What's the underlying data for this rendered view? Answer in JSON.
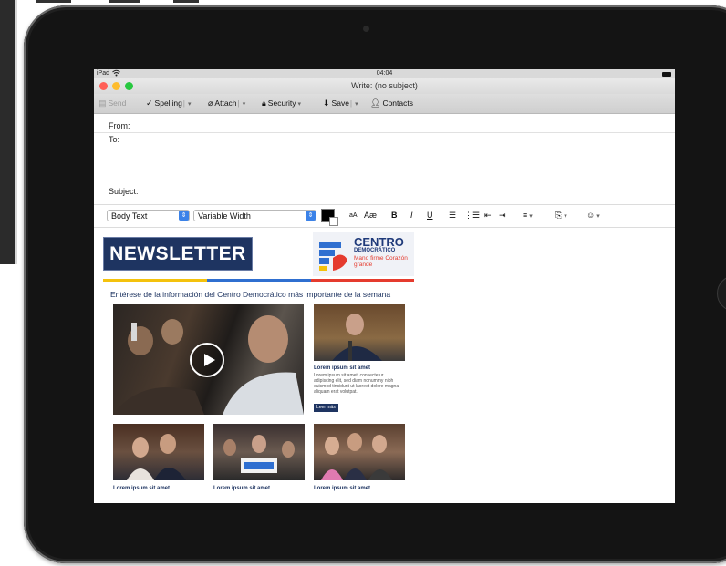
{
  "status_bar": {
    "device": "iPad",
    "time": "04:04"
  },
  "window": {
    "title": "Write: (no subject)"
  },
  "toolbar": {
    "send": "Send",
    "spelling": "Spelling",
    "attach": "Attach",
    "security": "Security",
    "save": "Save",
    "contacts": "Contacts"
  },
  "header": {
    "from_label": "From:",
    "to_label": "To:",
    "subject_label": "Subject:"
  },
  "format_bar": {
    "paragraph_style": "Body Text",
    "font": "Variable Width",
    "smaller_label": "aA",
    "larger_label": "Aæ",
    "bold": "B",
    "italic": "I",
    "underline": "U"
  },
  "newsletter": {
    "title": "NEWSLETTER",
    "logo_title": "CENTRO",
    "logo_subtitle": "DEMOCRÁTICO",
    "logo_slogan": "Mano firme Corazón grande",
    "tagline": "Entérese de la información del Centro Democrático más importante de la semana",
    "featured": {
      "headline": "Lorem ipsum sit amet",
      "body": "Lorem ipsum sit amet, consectetur adipiscing elit, sed diam nonummy nibh euismod tincidunt ut laoreet dolore magna aliquam erat volutpat.",
      "button": "Leer más"
    },
    "cards": [
      {
        "headline": "Lorem ipsum sit amet"
      },
      {
        "headline": "Lorem ipsum sit amet"
      },
      {
        "headline": "Lorem ipsum sit amet"
      }
    ]
  },
  "colors": {
    "navy": "#1e3461",
    "stripe_yellow": "#f4c20d",
    "stripe_blue": "#2f6fd0",
    "stripe_red": "#e53b2e",
    "traffic_red": "#ff5f57",
    "traffic_yellow": "#febc2e",
    "traffic_green": "#28c840"
  }
}
